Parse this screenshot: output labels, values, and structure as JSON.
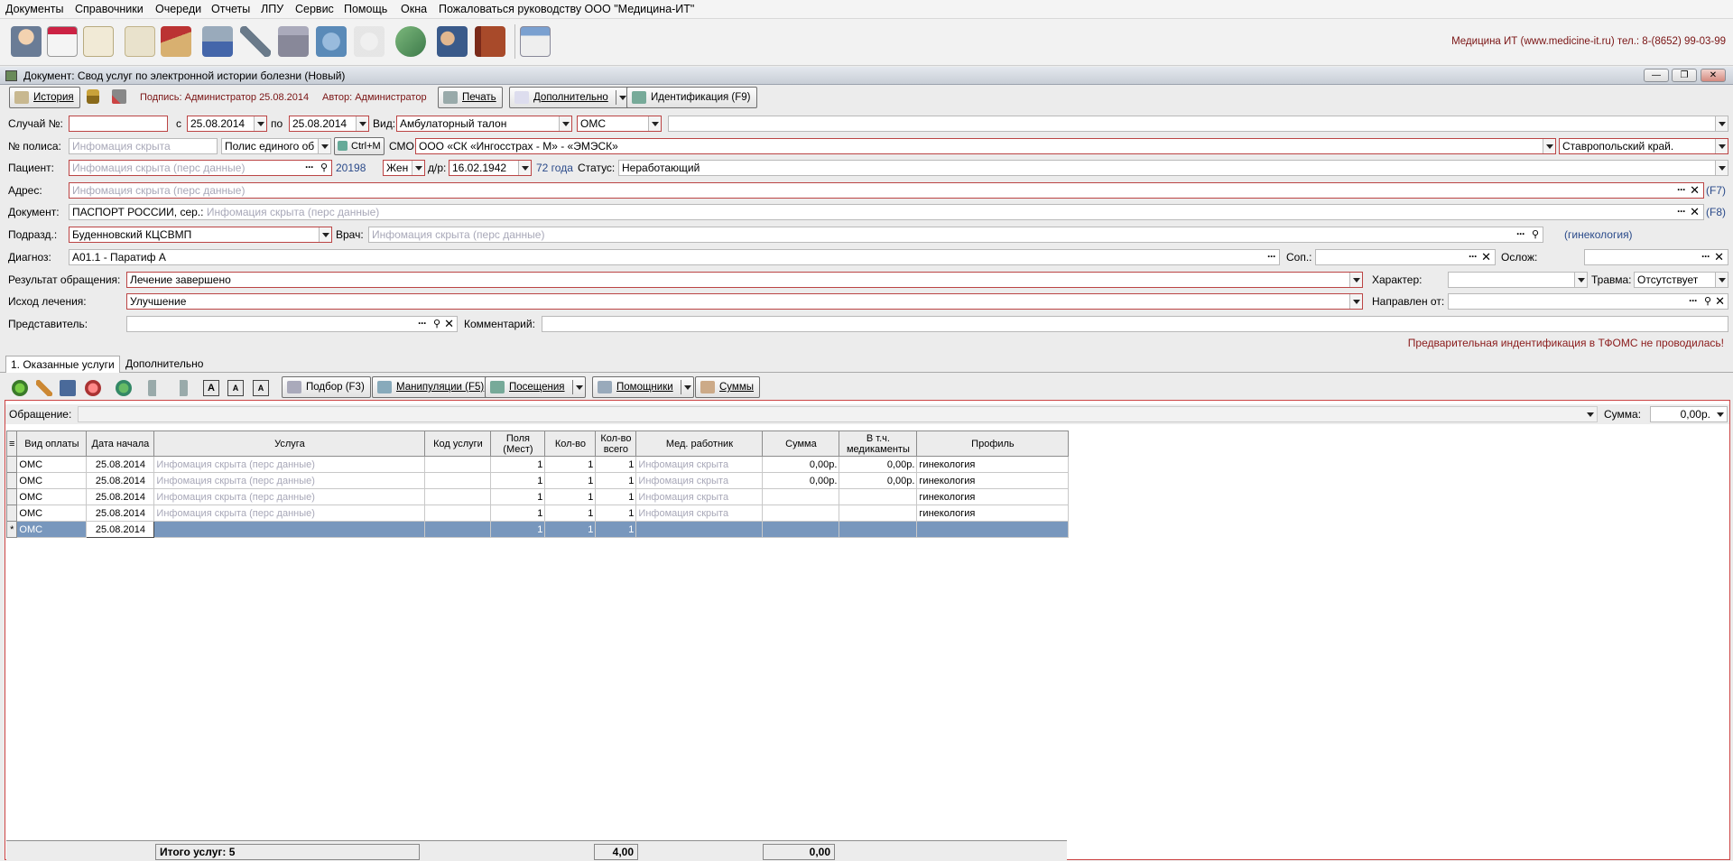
{
  "menu": [
    "Документы",
    "Справочники",
    "Очереди",
    "Отчеты",
    "ЛПУ",
    "Сервис",
    "Помощь",
    "Окна",
    "Пожаловаться руководству ООО \"Медицина-ИТ\""
  ],
  "company": "Медицина ИТ (www.medicine-it.ru) тел.: 8-(8652) 99-03-99",
  "toolbar_icons": [
    "doctor-icon",
    "calendar-icon",
    "document-icon",
    "card-icon",
    "home-icon",
    "lab-icon",
    "syringe-icon",
    "building-icon",
    "basket-icon",
    "pills-icon",
    "capsule-icon",
    "users-icon",
    "book-icon",
    "schedule-icon"
  ],
  "doc": {
    "title": "Документ: Свод услуг по электронной истории болезни (Новый)",
    "history": "История",
    "signature": "Подпись: Администратор 25.08.2014",
    "author": "Автор: Администратор",
    "print": "Печать",
    "extra": "Дополнительно",
    "ident": "Идентификация (F9)"
  },
  "form": {
    "case_label": "Случай №:",
    "from_label": "с",
    "date_from": "25.08.2014",
    "to_label": "по",
    "date_to": "25.08.2014",
    "kind_label": "Вид:",
    "kind": "Амбулаторный талон",
    "pay": "ОМС",
    "policy_label": "№ полиса:",
    "policy_ph": "Инфомация скрыта",
    "policy_type": "Полис единого об",
    "ctrl_m": "Ctrl+M",
    "smo_label": "СМО:",
    "smo": "ООО «СК «Ингосстрах - М» - «ЭМЭСК»",
    "region": "Ставропольский край.",
    "patient_label": "Пациент:",
    "patient_ph": "Инфомация скрыта (перс данные)",
    "patient_id": "20198",
    "sex": "Жен",
    "dob_label": "д/р:",
    "dob": "16.02.1942",
    "age": "72 года",
    "status_label": "Статус:",
    "status": "Неработающий",
    "address_label": "Адрес:",
    "address_ph": "Инфомация скрыта (перс данные)",
    "f7": "(F7)",
    "document_label": "Документ:",
    "document_val": "ПАСПОРТ РОССИИ, сер.:",
    "document_ph": "Инфомация скрыта (перс данные)",
    "f8": "(F8)",
    "subdiv_label": "Подразд.:",
    "subdiv": "Буденновский КЦСВМП",
    "doctor_label": "Врач:",
    "doctor_ph": "Инфомация скрыта (перс данные)",
    "specialty": "(гинекология)",
    "diag_label": "Диагноз:",
    "diag": "A01.1 - Паратиф А",
    "sop_label": "Соп.:",
    "oslozh_label": "Ослож:",
    "result_label": "Результат обращения:",
    "result": "Лечение завершено",
    "character_label": "Характер:",
    "trauma_label": "Травма:",
    "trauma": "Отсутствует",
    "outcome_label": "Исход лечения:",
    "outcome": "Улучшение",
    "directed_label": "Направлен от:",
    "rep_label": "Представитель:",
    "comment_label": "Комментарий:",
    "tfoms": "Предварительная индентификация в ТФОМС не проводилась!"
  },
  "tabs": [
    "1. Оказанные услуги",
    "Дополнительно"
  ],
  "svc": {
    "podbor": "Подбор (F3)",
    "manip": "Манипуляции (F5)",
    "visits": "Посещения",
    "helpers": "Помощники",
    "sums": "Суммы",
    "obr_label": "Обращение:",
    "sum_label": "Сумма:",
    "sum": "0,00р."
  },
  "grid": {
    "headers": [
      "Вид оплаты",
      "Дата начала",
      "Услуга",
      "Код услуги",
      "Поля (Мест)",
      "Кол-во",
      "Кол-во всего",
      "Мед. работник",
      "Сумма",
      "В т.ч. медикаменты",
      "Профиль"
    ],
    "rows": [
      [
        "ОМС",
        "25.08.2014",
        "Инфомация скрыта (перс данные)",
        "",
        "1",
        "1",
        "1",
        "Инфомация скрыта",
        "0,00р.",
        "0,00р.",
        "гинекология"
      ],
      [
        "ОМС",
        "25.08.2014",
        "Инфомация скрыта (перс данные)",
        "",
        "1",
        "1",
        "1",
        "Инфомация скрыта",
        "0,00р.",
        "0,00р.",
        "гинекология"
      ],
      [
        "ОМС",
        "25.08.2014",
        "Инфомация скрыта (перс данные)",
        "",
        "1",
        "1",
        "1",
        "Инфомация скрыта",
        "",
        "",
        "гинекология"
      ],
      [
        "ОМС",
        "25.08.2014",
        "Инфомация скрыта (перс данные)",
        "",
        "1",
        "1",
        "1",
        "Инфомация скрыта",
        "",
        "",
        "гинекология"
      ],
      [
        "ОМС",
        "25.08.2014",
        "",
        "",
        "1",
        "1",
        "1",
        "",
        "",
        "",
        ""
      ]
    ],
    "new_row_marker": "*",
    "total_label": "Итого услуг: 5",
    "total_qty": "4,00",
    "total_sum": "0,00"
  }
}
